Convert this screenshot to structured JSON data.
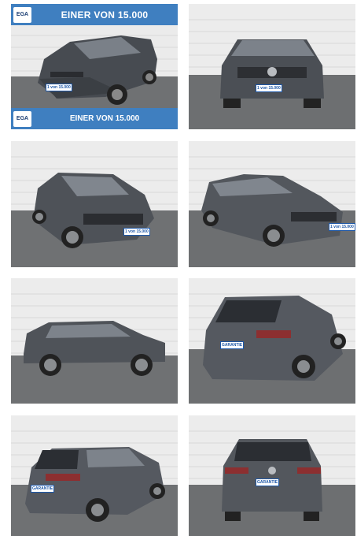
{
  "gallery": {
    "tiles": [
      {
        "name": "front-three-quarter-left",
        "banner_top": "EINER VON 15.000",
        "banner_bottom": "EINER VON 15.000",
        "badge": "EGA",
        "plate": "1 von 15.000",
        "view": "fl"
      },
      {
        "name": "front",
        "plate": "1 von 15.000",
        "view": "front"
      },
      {
        "name": "front-three-quarter-left-close",
        "plate": "1 von 15.000",
        "view": "fl"
      },
      {
        "name": "front-three-quarter-right",
        "plate": "1 von 15.000",
        "view": "fr"
      },
      {
        "name": "side-left",
        "view": "side"
      },
      {
        "name": "rear-three-quarter-right",
        "plate": "GARANTIE",
        "view": "rr"
      },
      {
        "name": "rear-three-quarter-left",
        "plate": "GARANTIE",
        "view": "rl"
      },
      {
        "name": "rear",
        "plate": "GARANTIE",
        "view": "rear"
      }
    ]
  },
  "colors": {
    "banner": "#3f7fc0",
    "car": "#4f5359",
    "wall": "#ececec",
    "floor": "#6d6f71"
  },
  "icons": {
    "badge": "ega-logo-icon"
  }
}
